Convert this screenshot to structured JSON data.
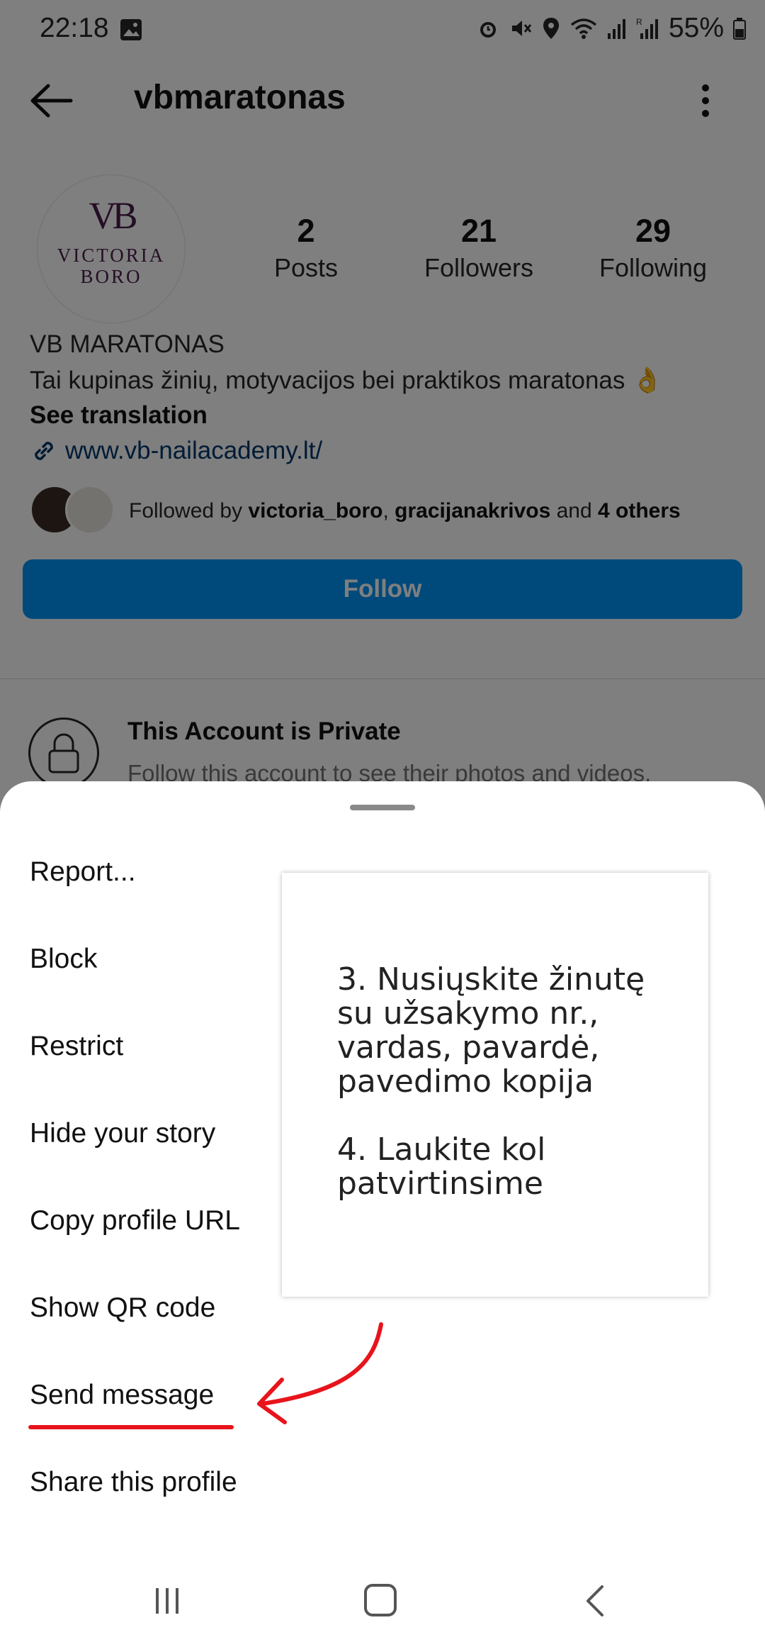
{
  "status_bar": {
    "time": "22:18",
    "battery": "55%",
    "icons": [
      "image-icon",
      "alarm-icon",
      "mute-icon",
      "location-icon",
      "wifi-icon",
      "signal-icon",
      "signal-r-icon",
      "battery-icon"
    ]
  },
  "header": {
    "username": "vbmaratonas"
  },
  "profile": {
    "avatar_logo": {
      "monogram": "VB",
      "line1": "VICTORIA",
      "line2": "BORO"
    },
    "stats": [
      {
        "value": "2",
        "label": "Posts"
      },
      {
        "value": "21",
        "label": "Followers"
      },
      {
        "value": "29",
        "label": "Following"
      }
    ],
    "name": "VB MARATONAS",
    "bio": "Tai kupinas žinių, motyvacijos bei praktikos maratonas 👌",
    "see_translation": "See translation",
    "link": "www.vb-nailacademy.lt/",
    "followed_by": {
      "prefix": "Followed by ",
      "user1": "victoria_boro",
      "sep": ", ",
      "user2": "gracijanakrivos",
      "mid": " and ",
      "others": "4 others"
    },
    "follow_label": "Follow",
    "private_title": "This Account is Private",
    "private_sub": "Follow this account to see their photos and videos."
  },
  "sheet": {
    "items": [
      {
        "label": "Report..."
      },
      {
        "label": "Block"
      },
      {
        "label": "Restrict"
      },
      {
        "label": "Hide your story"
      },
      {
        "label": "Copy profile URL"
      },
      {
        "label": "Show QR code"
      },
      {
        "label": "Send message"
      },
      {
        "label": "Share this profile"
      }
    ]
  },
  "instruction_card": {
    "step3": "3. Nusiųskite žinutę su užsakymo nr., vardas, pavardė, pavedimo kopija",
    "step4": "4. Laukite kol patvirtinsime"
  },
  "colors": {
    "follow_blue": "#0095f6",
    "link_blue": "#00376b",
    "annotation_red": "#e8141b",
    "logo_purple": "#4a1d4a"
  }
}
